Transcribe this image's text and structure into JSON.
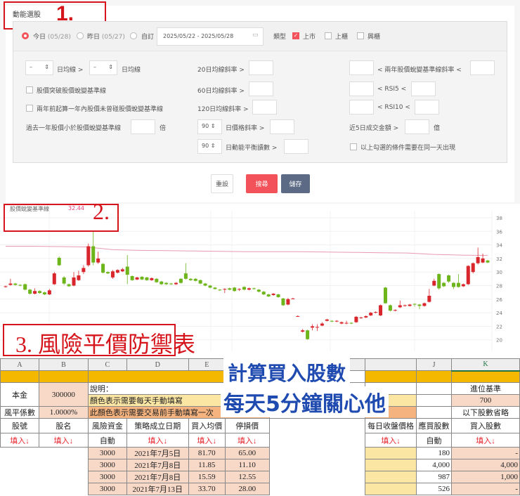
{
  "section1": {
    "marker": "1.",
    "title": "動能選股",
    "date_options": [
      {
        "label": "今日",
        "date": "(05/28)",
        "selected": true
      },
      {
        "label": "昨日",
        "date": "(05/27)",
        "selected": false
      },
      {
        "label": "自訂",
        "date": "",
        "selected": false
      }
    ],
    "date_range": "2025/05/22 - 2025/05/28",
    "type_label": "類型",
    "types": [
      {
        "label": "上市",
        "checked": true
      },
      {
        "label": "上櫃",
        "checked": false
      },
      {
        "label": "興櫃",
        "checked": false
      }
    ],
    "ma_select_a": "–",
    "ma_gt": "日均線 >",
    "ma_select_b": "–",
    "ma_label": "日均線",
    "break_label": "股價突破股價蛻變基準線",
    "two_years_label": "兩年前起算一年內股價未曾碰股價蛻變基準線",
    "below_label": "過去一年股價小於股價蛻變基準線",
    "below_unit": "倍",
    "slope20": "20日均線斜率 >",
    "slope60": "60日均線斜率 >",
    "slope120": "120日均線斜率 >",
    "price_slope_sel": "90",
    "price_slope": "日價格斜率 >",
    "momentum_sel": "90",
    "momentum": "日動能平衡讀數 >",
    "base_slope": "< 兩年股價蛻變基準線斜率 <",
    "rsi5": "< RSI5 <",
    "rsi10": "< RSI10 <",
    "turnover": "近5日成交金額 >",
    "turnover_unit": "億",
    "same_day": "以上勾選的條件需要在同一天出現",
    "buttons": {
      "reset": "重設",
      "search": "搜尋",
      "save": "儲存"
    },
    "colors": {
      "accent": "#f4525a",
      "save": "#5d6a86"
    }
  },
  "section2": {
    "marker": "2.",
    "legend_label": "股價蛻變基準線",
    "legend_value": "32.44"
  },
  "chart_data": {
    "type": "candlestick",
    "yticks": [
      38,
      36,
      34,
      32,
      30,
      28,
      26,
      24,
      22,
      20
    ],
    "ylim": [
      19.5,
      38.5
    ],
    "series_ohlc_format": "[open,close,high,low]",
    "candles": [
      [
        27.8,
        27.9,
        28,
        27.7
      ],
      [
        28.1,
        28.3,
        29,
        28
      ],
      [
        28.3,
        28.1,
        28.4,
        28
      ],
      [
        28.1,
        28,
        28.2,
        27.9
      ],
      [
        28.2,
        27.4,
        28.3,
        27.3
      ],
      [
        27.4,
        26.8,
        27.5,
        26.7
      ],
      [
        26.8,
        27.2,
        27.6,
        26.7
      ],
      [
        27.2,
        26.9,
        27.3,
        26.8
      ],
      [
        27,
        26.7,
        27.1,
        26.6
      ],
      [
        26.7,
        27.3,
        27.5,
        26.6
      ],
      [
        28.2,
        29.8,
        30,
        28.1
      ],
      [
        32.1,
        31,
        32.3,
        30.9
      ],
      [
        29.2,
        28.3,
        29.4,
        28.1
      ],
      [
        28.2,
        27.9,
        28.3,
        27.8
      ],
      [
        28,
        29.2,
        30,
        27.9
      ],
      [
        28.8,
        29.5,
        30.2,
        28.7
      ],
      [
        30,
        30.6,
        31,
        29.7
      ],
      [
        31,
        33.8,
        34.2,
        30.8
      ],
      [
        33.8,
        31.4,
        36,
        31
      ],
      [
        31.4,
        32,
        33,
        31.2
      ],
      [
        31.2,
        29.9,
        31.3,
        29.8
      ],
      [
        30,
        29.8,
        30.1,
        29.7
      ],
      [
        29.2,
        30.1,
        30.3,
        29
      ],
      [
        29.9,
        30.3,
        30.4,
        29.8
      ],
      [
        30.1,
        30.4,
        30.6,
        30
      ],
      [
        30.8,
        29.6,
        32.5,
        28.2
      ],
      [
        29.4,
        28.8,
        29.5,
        28.7
      ],
      [
        28.9,
        29.2,
        29.3,
        28.8
      ],
      [
        29.3,
        28.9,
        29.4,
        28.8
      ],
      [
        29.2,
        28.8,
        29.3,
        28.7
      ],
      [
        28.8,
        29.1,
        29.2,
        28.7
      ],
      [
        29,
        28.5,
        29.1,
        28.4
      ],
      [
        28.6,
        28.2,
        28.7,
        28.1
      ],
      [
        28.4,
        28.2,
        28.5,
        28.1
      ],
      [
        28.3,
        28.2,
        28.4,
        28.1
      ],
      [
        28.2,
        28.4,
        28.5,
        28.1
      ],
      [
        29,
        28.4,
        29.1,
        28.3
      ],
      [
        29.8,
        29,
        31.3,
        28.9
      ],
      [
        29,
        28.8,
        29.1,
        28.7
      ],
      [
        29,
        28.7,
        29.1,
        28.6
      ],
      [
        28.8,
        28.3,
        28.9,
        28.2
      ],
      [
        28.3,
        28,
        28.4,
        27.9
      ],
      [
        28,
        27.7,
        28.1,
        27.6
      ],
      [
        27.7,
        27.5,
        27.8,
        27.4
      ],
      [
        27.4,
        27.3,
        27.5,
        27.2
      ],
      [
        27.4,
        27.5,
        27.6,
        26.9
      ],
      [
        27.6,
        27.4,
        27.7,
        27.3
      ],
      [
        27.7,
        27.2,
        27.8,
        27.1
      ],
      [
        27.4,
        27.5,
        27.6,
        27.2
      ],
      [
        27.8,
        27.4,
        27.9,
        27.3
      ],
      [
        27.4,
        27.6,
        27.7,
        27.3
      ],
      [
        27.6,
        27.5,
        27.7,
        27.4
      ],
      [
        27.4,
        27.1,
        27.5,
        27
      ],
      [
        27.1,
        26.7,
        27.2,
        26.6
      ],
      [
        26.7,
        26.4,
        26.8,
        26.3
      ],
      [
        26.6,
        26.8,
        26.9,
        26.5
      ],
      [
        26.7,
        26.3,
        26.8,
        26.2
      ],
      [
        26.1,
        25.1,
        26.2,
        25
      ],
      [
        25.2,
        26,
        26.2,
        25.1
      ],
      [
        26.1,
        26.1,
        26.2,
        26
      ],
      [
        23.5,
        23.5,
        23.6,
        23.4
      ],
      [
        21.2,
        21.4,
        21.6,
        21.1
      ],
      [
        21.4,
        20.1,
        21.5,
        20
      ],
      [
        21.8,
        22,
        22.3,
        21.4
      ],
      [
        21.8,
        21.9,
        22.3,
        21.3
      ],
      [
        22.1,
        22.4,
        22.6,
        22
      ],
      [
        22.8,
        23,
        23.1,
        22.7
      ],
      [
        22.8,
        22.7,
        22.9,
        22.6
      ],
      [
        22.7,
        22.8,
        22.9,
        22.6
      ],
      [
        22.4,
        22.6,
        22.7,
        22.3
      ],
      [
        22.4,
        22.5,
        22.8,
        22.3
      ],
      [
        22.5,
        22.4,
        22.6,
        22.3
      ],
      [
        22.6,
        23.4,
        23.5,
        22.5
      ],
      [
        23.2,
        23.3,
        23.4,
        23.1
      ],
      [
        23.3,
        23.5,
        23.6,
        23.2
      ],
      [
        23.6,
        24,
        24.1,
        23.5
      ],
      [
        24,
        24.1,
        24.2,
        23.9
      ],
      [
        23.6,
        25.1,
        25.2,
        23.5
      ],
      [
        27.7,
        25.4,
        27.8,
        25.3
      ],
      [
        25.1,
        24.3,
        25.2,
        24.2
      ],
      [
        24.3,
        24.4,
        24.5,
        24.2
      ],
      [
        24.8,
        25.1,
        25.8,
        24.7
      ],
      [
        25,
        25.1,
        25.2,
        24.9
      ],
      [
        25,
        25.2,
        25.3,
        24.9
      ],
      [
        25.3,
        25.2,
        25.4,
        24.9
      ],
      [
        25.2,
        25,
        25.3,
        24.5
      ],
      [
        25,
        25.4,
        25.5,
        24.9
      ],
      [
        25.6,
        26.5,
        27.5,
        25.5
      ],
      [
        28,
        28.7,
        29,
        27.9
      ],
      [
        29.7,
        27.6,
        29.8,
        27.4
      ],
      [
        28.4,
        27.9,
        28.5,
        27.8
      ],
      [
        29.5,
        28.6,
        29.6,
        28.4
      ],
      [
        28.4,
        27.8,
        28.5,
        27.5
      ],
      [
        28.4,
        27.8,
        29.7,
        27.7
      ],
      [
        27.9,
        28.2,
        28.3,
        27.8
      ],
      [
        28.2,
        30.9,
        31,
        28.1
      ],
      [
        30,
        31.3,
        31.4,
        29.8
      ],
      [
        31.3,
        32.2,
        33.6,
        31.1
      ],
      [
        31.4,
        32,
        32.7,
        31.3
      ],
      [
        31.7,
        31.4,
        31.8,
        31.3
      ]
    ],
    "baseline": [
      33.8,
      33.8,
      33.75,
      33.7,
      33.3,
      33.2,
      33.15,
      33.1,
      33.05,
      33,
      33,
      33,
      32.95,
      32.9,
      32.85,
      32.8,
      32.6,
      32.5,
      32.44
    ],
    "colors": {
      "up": "#d9262c",
      "down": "#6db51b",
      "baseline": "#e89ab0"
    }
  },
  "section3": {
    "marker": "3.",
    "title": "風險平價防禦表",
    "overlay_line1": "計算買入股數",
    "overlay_line2": "每天5分鐘關心他",
    "col_letters": [
      "A",
      "B",
      "C",
      "D",
      "E",
      "J",
      "K"
    ],
    "capital_label": "本金",
    "capital": "300000",
    "note_label": "說明：",
    "note_yellow": "顏色表示需要每天手動填寫",
    "note_orange": "此顏色表示需要交易前手動填寫一次",
    "risk_label": "風平係數",
    "risk_value": "1.0000%",
    "round_label": "進位基準",
    "round_value": "700",
    "omit_label": "以下股數省略",
    "headers": [
      "股號",
      "股名",
      "風險資金",
      "策略成立日期",
      "買入均價",
      "停損價",
      "每日收盤價格",
      "應買股數",
      "買入股數"
    ],
    "hints": [
      "填入↓",
      "填入↓",
      "自動",
      "填入↓",
      "填入↓",
      "填入↓",
      "填入↓",
      "自動",
      "填入↓"
    ],
    "rows": [
      [
        "3000",
        "2021年7月5日",
        "81.70",
        "65.00",
        "180",
        "-"
      ],
      [
        "3000",
        "2021年7月8日",
        "11.85",
        "11.10",
        "4,000",
        "4,000"
      ],
      [
        "3000",
        "2021年7月8日",
        "15.59",
        "12.55",
        "987",
        "1,000"
      ],
      [
        "3000",
        "2021年7月13日",
        "33.70",
        "28.00",
        "526",
        "-"
      ]
    ]
  }
}
